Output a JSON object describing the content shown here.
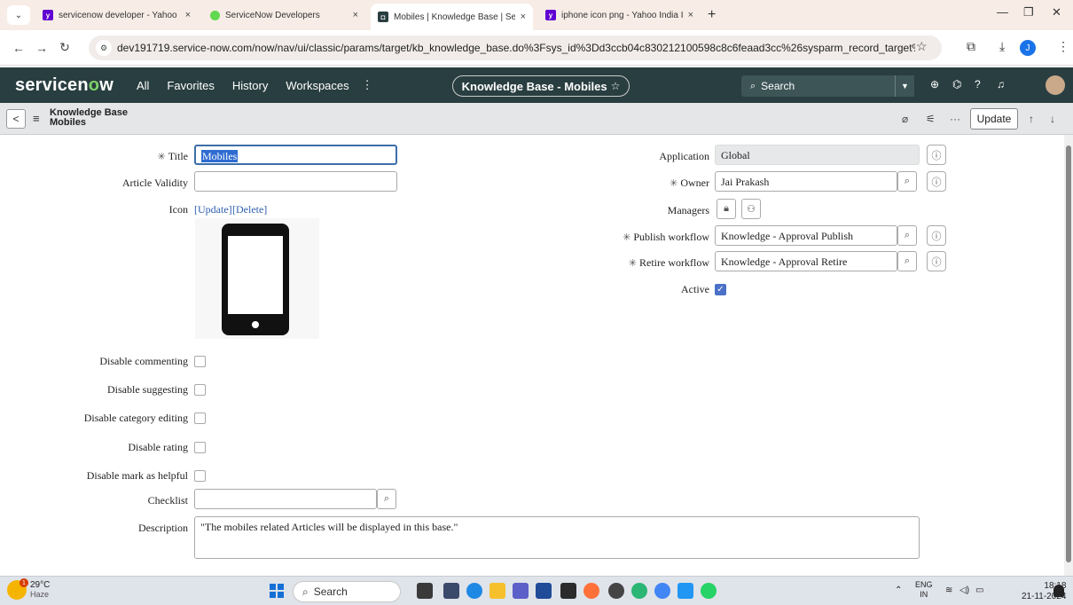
{
  "browser": {
    "tabs": [
      {
        "label": "servicenow developer - Yahoo I",
        "favicon": "yahoo-icon",
        "active": false
      },
      {
        "label": "ServiceNow Developers",
        "favicon": "servicenow-icon",
        "active": false
      },
      {
        "label": "Mobiles | Knowledge Base | Ser",
        "favicon": "knowledge-icon",
        "active": true
      },
      {
        "label": "iphone icon png - Yahoo India I",
        "favicon": "yahoo-icon",
        "active": false
      }
    ],
    "close_glyph": "×",
    "new_tab_glyph": "+",
    "url": "dev191719.service-now.com/now/nav/ui/classic/params/target/kb_knowledge_base.do%3Fsys_id%3Dd3ccb04c830212100598c8c6feaad3cc%26sysparm_record_target%3Dkb_knowledge_...",
    "profile_initial": "J"
  },
  "header": {
    "logo_pre": "servicen",
    "logo_o": "o",
    "logo_post": "w",
    "nav": [
      "All",
      "Favorites",
      "History",
      "Workspaces"
    ],
    "more_glyph": "⋮",
    "context_pill": "Knowledge Base - Mobiles",
    "search_placeholder": "Search"
  },
  "record": {
    "breadcrumb_parent": "Knowledge Base",
    "breadcrumb_current": "Mobiles",
    "update_label": "Update"
  },
  "form": {
    "title_label": "Title",
    "title_value": "Mobiles",
    "article_validity_label": "Article Validity",
    "article_validity_value": "",
    "icon_label": "Icon",
    "icon_update": "[Update]",
    "icon_delete": "[Delete]",
    "application_label": "Application",
    "application_value": "Global",
    "owner_label": "Owner",
    "owner_value": "Jai Prakash",
    "managers_label": "Managers",
    "publish_workflow_label": "Publish workflow",
    "publish_workflow_value": "Knowledge - Approval Publish",
    "retire_workflow_label": "Retire workflow",
    "retire_workflow_value": "Knowledge - Approval Retire",
    "active_label": "Active",
    "active_checked": true,
    "checkboxes": [
      {
        "label": "Disable commenting",
        "checked": false
      },
      {
        "label": "Disable suggesting",
        "checked": false
      },
      {
        "label": "Disable category editing",
        "checked": false
      },
      {
        "label": "Disable rating",
        "checked": false
      },
      {
        "label": "Disable mark as helpful",
        "checked": false
      }
    ],
    "checklist_label": "Checklist",
    "checklist_value": "",
    "description_label": "Description",
    "description_value": "\"The mobiles related Articles will be displayed in this base.\""
  },
  "taskbar": {
    "temperature": "29°C",
    "weather": "Haze",
    "weather_badge": "1",
    "search_label": "Search",
    "lang_top": "ENG",
    "lang_bottom": "IN",
    "time": "18:18",
    "date": "21-11-2024"
  }
}
